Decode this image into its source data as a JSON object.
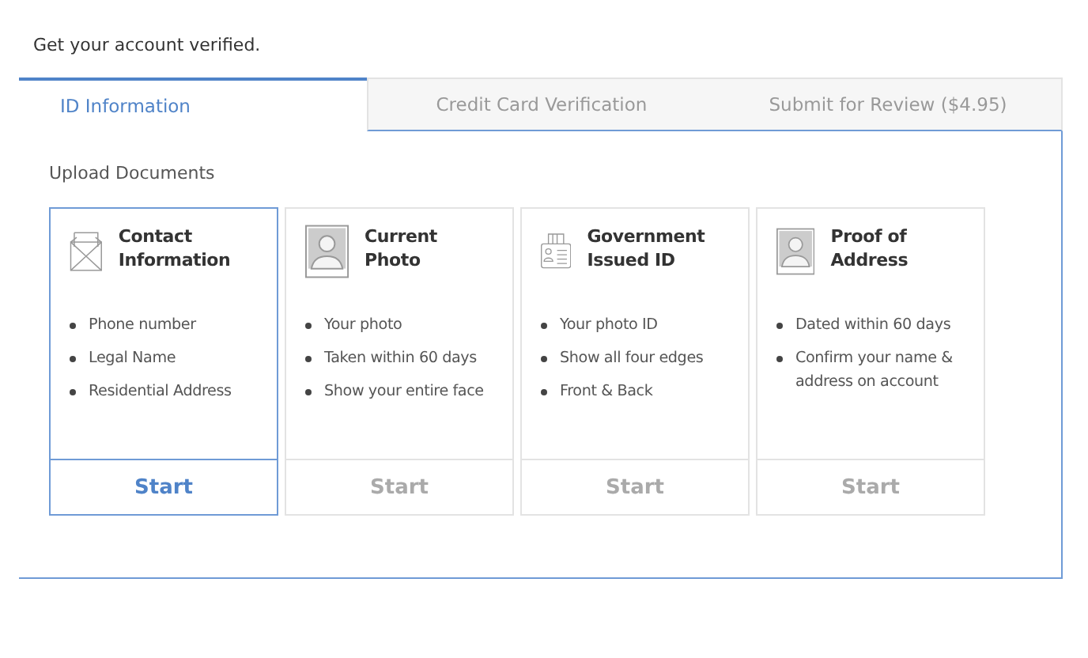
{
  "heading": "Get your account verified.",
  "tabs": [
    {
      "label": "ID Information",
      "selected": true
    },
    {
      "label": "Credit Card Verification",
      "selected": false
    },
    {
      "label": "Submit for Review ($4.95)",
      "selected": false
    }
  ],
  "section_title": "Upload Documents",
  "cards": [
    {
      "kind": "envelope",
      "title": "Contact Information",
      "items": [
        "Phone number",
        "Legal Name",
        "Residential Address"
      ],
      "button": "Start",
      "active": true
    },
    {
      "kind": "portrait",
      "title": "Current Photo",
      "items": [
        "Your photo",
        "Taken within 60 days",
        "Show your entire face"
      ],
      "button": "Start",
      "active": false
    },
    {
      "kind": "idcard",
      "title": "Government Issued ID",
      "items": [
        "Your photo ID",
        "Show all four edges",
        "Front & Back"
      ],
      "button": "Start",
      "active": false
    },
    {
      "kind": "portrait",
      "title": "Proof of Address",
      "items": [
        "Dated within 60 days",
        "Confirm your name & address on account"
      ],
      "button": "Start",
      "active": false
    }
  ]
}
